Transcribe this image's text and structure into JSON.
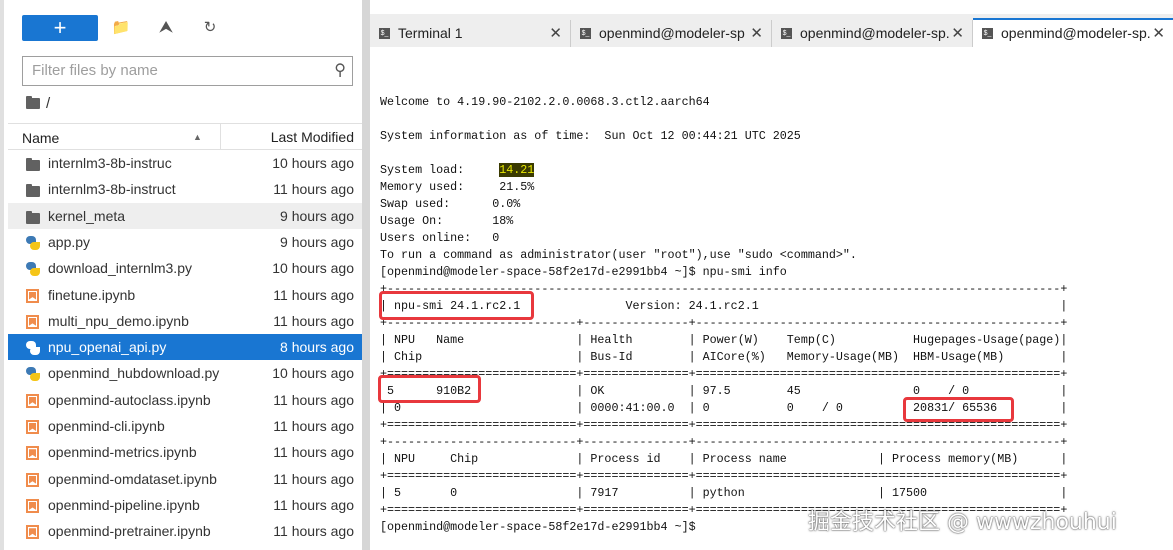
{
  "toolbar": {
    "new_label": "+",
    "new_folder": "new-folder-icon",
    "upload": "upload-icon",
    "refresh": "refresh-icon"
  },
  "filter": {
    "placeholder": "Filter files by name"
  },
  "breadcrumb": "/",
  "columns": {
    "name": "Name",
    "modified": "Last Modified"
  },
  "files": [
    {
      "name": "internlm3-8b-instruc",
      "type": "folder",
      "modified": "10 hours ago"
    },
    {
      "name": "internlm3-8b-instruct",
      "type": "folder",
      "modified": "11 hours ago"
    },
    {
      "name": "kernel_meta",
      "type": "folder",
      "modified": "9 hours ago"
    },
    {
      "name": "app.py",
      "type": "python",
      "modified": "9 hours ago"
    },
    {
      "name": "download_internlm3.py",
      "type": "python",
      "modified": "10 hours ago"
    },
    {
      "name": "finetune.ipynb",
      "type": "notebook",
      "modified": "11 hours ago"
    },
    {
      "name": "multi_npu_demo.ipynb",
      "type": "notebook",
      "modified": "11 hours ago"
    },
    {
      "name": "npu_openai_api.py",
      "type": "python",
      "modified": "8 hours ago"
    },
    {
      "name": "openmind_hubdownload.py",
      "type": "python",
      "modified": "10 hours ago"
    },
    {
      "name": "openmind-autoclass.ipynb",
      "type": "notebook",
      "modified": "11 hours ago"
    },
    {
      "name": "openmind-cli.ipynb",
      "type": "notebook",
      "modified": "11 hours ago"
    },
    {
      "name": "openmind-metrics.ipynb",
      "type": "notebook",
      "modified": "11 hours ago"
    },
    {
      "name": "openmind-omdataset.ipynb",
      "type": "notebook",
      "modified": "11 hours ago"
    },
    {
      "name": "openmind-pipeline.ipynb",
      "type": "notebook",
      "modified": "11 hours ago"
    },
    {
      "name": "openmind-pretrainer.ipynb",
      "type": "notebook",
      "modified": "11 hours ago"
    }
  ],
  "tabs": [
    {
      "label": "Terminal 1"
    },
    {
      "label": "openmind@modeler-sp"
    },
    {
      "label": "openmind@modeler-sp."
    },
    {
      "label": "openmind@modeler-sp."
    }
  ],
  "terminal": {
    "welcome": "Welcome to 4.19.90-2102.2.0.0068.3.ctl2.aarch64",
    "sysinfo": "System information as of time:  Sun Oct 12 00:44:21 UTC 2025",
    "load_label": "System load:     ",
    "load_value": "14.21",
    "stats": [
      "Memory used:     21.5%",
      "Swap used:      0.0%",
      "Usage On:       18%",
      "Users online:   0"
    ],
    "admin": "To run a command as administrator(user \"root\"),use \"sudo <command>\".",
    "prompt_cmd": "[openmind@modeler-space-58f2e17d-e2991bb4 ~]$ npu-smi info",
    "smi_version": "npu-smi 24.1.rc2.1",
    "version": "Version: 24.1.rc2.1",
    "header1": [
      "NPU",
      "Name",
      "Health",
      "Power(W)",
      "Temp(C)",
      "Hugepages-Usage(page)"
    ],
    "header2": [
      "Chip",
      "Bus-Id",
      "AICore(%)",
      "Memory-Usage(MB)",
      "HBM-Usage(MB)"
    ],
    "row1": [
      "5",
      "910B2",
      "OK",
      "97.5",
      "45",
      "0    / 0"
    ],
    "row2": [
      "0",
      "0000:41:00.0",
      "0",
      "0    / 0",
      "20831/ 65536"
    ],
    "proc_header": [
      "NPU",
      "Chip",
      "Process id",
      "Process name",
      "Process memory(MB)"
    ],
    "proc_row": [
      "5",
      "0",
      "7917",
      "python",
      "17500"
    ],
    "prompt": "[openmind@modeler-space-58f2e17d-e2991bb4 ~]$"
  },
  "watermark": "掘金技术社区 @ wwwzhouhui"
}
